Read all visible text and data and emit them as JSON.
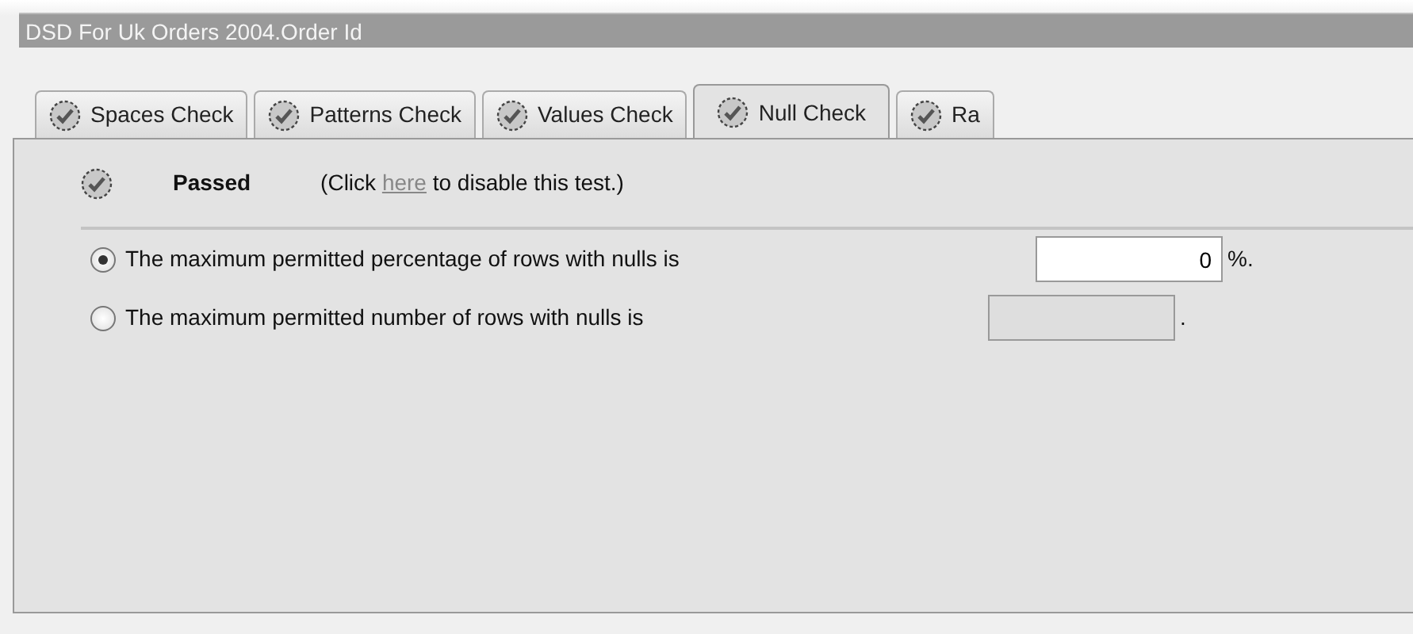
{
  "title_bar": {
    "title": "DSD For Uk Orders 2004.Order Id"
  },
  "tabs": [
    {
      "label": "Spaces Check",
      "selected": false
    },
    {
      "label": "Patterns Check",
      "selected": false
    },
    {
      "label": "Values Check",
      "selected": false
    },
    {
      "label": "Null Check",
      "selected": true
    },
    {
      "label": "Ra",
      "selected": false
    }
  ],
  "status": {
    "result": "Passed",
    "before": "(Click",
    "link": "here",
    "after": "to disable this test.)"
  },
  "options": [
    {
      "label": "The maximum permitted percentage of rows with nulls is",
      "selected": true,
      "value": "0",
      "disabled": false,
      "suffix": "%."
    },
    {
      "label": "The maximum permitted number of rows with nulls is",
      "selected": false,
      "disabled": true,
      "suffix": "."
    }
  ]
}
